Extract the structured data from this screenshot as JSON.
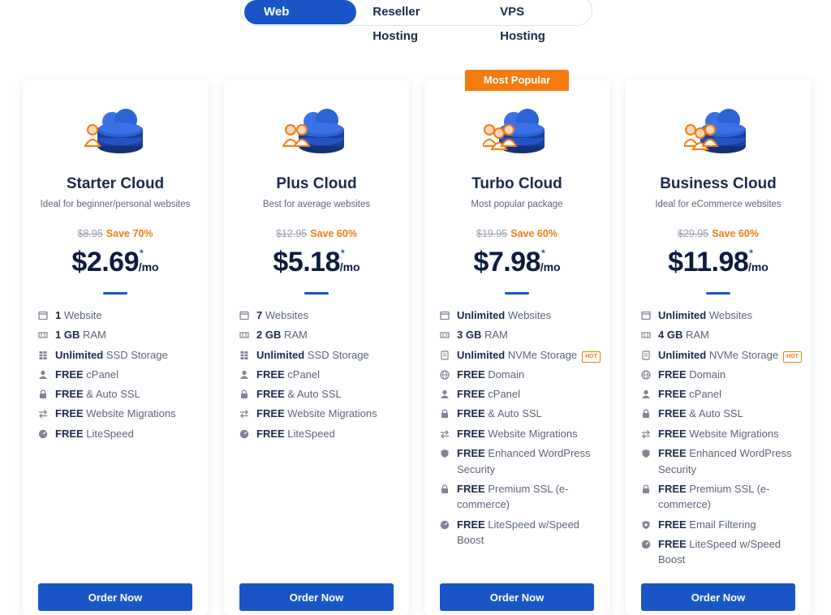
{
  "tabs": [
    {
      "label": "Web Hosting",
      "active": true
    },
    {
      "label": "Reseller Hosting",
      "active": false
    },
    {
      "label": "VPS Hosting",
      "active": false
    }
  ],
  "badge": "Most Popular",
  "colors": {
    "primary": "#1a55c8",
    "accent": "#f57b10",
    "text": "#1c2a4a"
  },
  "plans": [
    {
      "name": "Starter Cloud",
      "desc": "Ideal for beginner/personal websites",
      "old_price": "$8.95",
      "save": "Save 70%",
      "price": "$2.69",
      "asterisk": "*",
      "per": "/mo",
      "order": "Order Now",
      "features": [
        {
          "icon": "window-icon",
          "bold": "1",
          "text": " Website"
        },
        {
          "icon": "ram-icon",
          "bold": "1 GB",
          "text": " RAM"
        },
        {
          "icon": "storage-icon",
          "bold": "Unlimited",
          "text": " SSD Storage"
        },
        {
          "icon": "user-icon",
          "bold": "FREE",
          "text": " cPanel"
        },
        {
          "icon": "lock-icon",
          "bold": "FREE",
          "text": " & Auto SSL"
        },
        {
          "icon": "migrate-icon",
          "bold": "FREE",
          "text": " Website Migrations"
        },
        {
          "icon": "speed-icon",
          "bold": "FREE",
          "text": " LiteSpeed"
        }
      ]
    },
    {
      "name": "Plus Cloud",
      "desc": "Best for average websites",
      "old_price": "$12.95",
      "save": "Save 60%",
      "price": "$5.18",
      "asterisk": "*",
      "per": "/mo",
      "order": "Order Now",
      "features": [
        {
          "icon": "window-icon",
          "bold": "7",
          "text": " Websites"
        },
        {
          "icon": "ram-icon",
          "bold": "2 GB",
          "text": " RAM"
        },
        {
          "icon": "storage-icon",
          "bold": "Unlimited",
          "text": " SSD Storage"
        },
        {
          "icon": "user-icon",
          "bold": "FREE",
          "text": " cPanel"
        },
        {
          "icon": "lock-icon",
          "bold": "FREE",
          "text": " & Auto SSL"
        },
        {
          "icon": "migrate-icon",
          "bold": "FREE",
          "text": " Website Migrations"
        },
        {
          "icon": "speed-icon",
          "bold": "FREE",
          "text": " LiteSpeed"
        }
      ]
    },
    {
      "name": "Turbo Cloud",
      "desc": "Most popular package",
      "old_price": "$19.95",
      "save": "Save 60%",
      "price": "$7.98",
      "asterisk": "*",
      "per": "/mo",
      "order": "Order Now",
      "features": [
        {
          "icon": "window-icon",
          "bold": "Unlimited",
          "text": " Websites"
        },
        {
          "icon": "ram-icon",
          "bold": "3 GB",
          "text": " RAM"
        },
        {
          "icon": "nvme-icon",
          "bold": "Unlimited",
          "text": " NVMe Storage",
          "hot": "HOT"
        },
        {
          "icon": "globe-icon",
          "bold": "FREE",
          "text": " Domain"
        },
        {
          "icon": "user-icon",
          "bold": "FREE",
          "text": " cPanel"
        },
        {
          "icon": "lock-icon",
          "bold": "FREE",
          "text": " & Auto SSL"
        },
        {
          "icon": "migrate-icon",
          "bold": "FREE",
          "text": " Website Migrations"
        },
        {
          "icon": "shield-icon",
          "bold": "FREE",
          "text": " Enhanced WordPress Security"
        },
        {
          "icon": "lock-icon",
          "bold": "FREE",
          "text": " Premium SSL (e-commerce)"
        },
        {
          "icon": "speed-icon",
          "bold": "FREE",
          "text": " LiteSpeed w/Speed Boost"
        }
      ]
    },
    {
      "name": "Business Cloud",
      "desc": "Ideal for eCommerce websites",
      "old_price": "$29.95",
      "save": "Save 60%",
      "price": "$11.98",
      "asterisk": "*",
      "per": "/mo",
      "order": "Order Now",
      "features": [
        {
          "icon": "window-icon",
          "bold": "Unlimited",
          "text": " Websites"
        },
        {
          "icon": "ram-icon",
          "bold": "4 GB",
          "text": " RAM"
        },
        {
          "icon": "nvme-icon",
          "bold": "Unlimited",
          "text": " NVMe Storage",
          "hot": "HOT"
        },
        {
          "icon": "globe-icon",
          "bold": "FREE",
          "text": " Domain"
        },
        {
          "icon": "user-icon",
          "bold": "FREE",
          "text": " cPanel"
        },
        {
          "icon": "lock-icon",
          "bold": "FREE",
          "text": " & Auto SSL"
        },
        {
          "icon": "migrate-icon",
          "bold": "FREE",
          "text": " Website Migrations"
        },
        {
          "icon": "shield-icon",
          "bold": "FREE",
          "text": " Enhanced WordPress Security"
        },
        {
          "icon": "lock-icon",
          "bold": "FREE",
          "text": " Premium SSL (e-commerce)"
        },
        {
          "icon": "filter-icon",
          "bold": "FREE",
          "text": " Email Filtering"
        },
        {
          "icon": "speed-icon",
          "bold": "FREE",
          "text": " LiteSpeed w/Speed Boost"
        }
      ]
    }
  ]
}
